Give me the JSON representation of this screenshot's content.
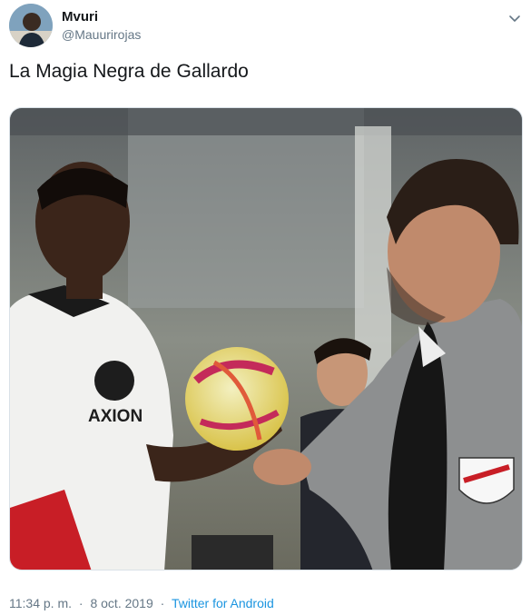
{
  "tweet": {
    "author": {
      "display_name": "Mvuri",
      "handle": "@Mauurirojas",
      "avatar_icon": "avatar-photo"
    },
    "text": "La Magia Negra de Gallardo",
    "media": {
      "icon": "photo",
      "jersey_text": "AXION"
    },
    "time": "11:34 p. m.",
    "date": "8 oct. 2019",
    "separator": "·",
    "source": "Twitter for Android",
    "menu_icon": "chevron-down-icon"
  },
  "colors": {
    "text": "#14171a",
    "secondary": "#657786",
    "link": "#1b95e0",
    "border": "#d9e1e7"
  }
}
